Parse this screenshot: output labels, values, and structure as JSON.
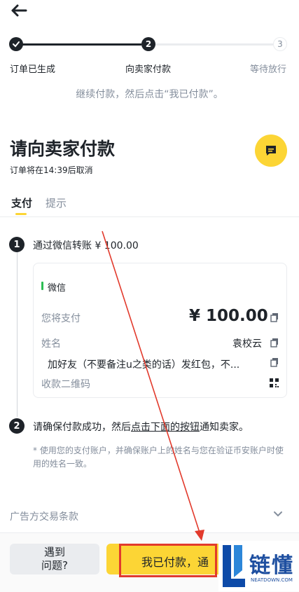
{
  "header": {
    "back_icon": "arrow-left-icon"
  },
  "stepper": {
    "steps": [
      {
        "label": "订单已生成",
        "number": "",
        "state": "done"
      },
      {
        "label": "向卖家付款",
        "number": "2",
        "state": "active"
      },
      {
        "label": "等待放行",
        "number": "3",
        "state": "pending"
      }
    ]
  },
  "hint": "继续付款，然后点击“我已付款”。",
  "page_title": "请向卖家付款",
  "cancel_info": "订单将在14:39后取消",
  "tabs": [
    {
      "label": "支付",
      "active": true
    },
    {
      "label": "提示",
      "active": false
    }
  ],
  "step1": {
    "number": "1",
    "text": "通过微信转账 ¥ 100.00"
  },
  "payment_card": {
    "method": "微信",
    "method_color": "#2dbd54",
    "amount_label": "您将支付",
    "amount_value": "¥ 100.00",
    "name_label": "姓名",
    "name_value": "袁校云",
    "remark_value": "加好友（不要备注u之类的话）发红包，不...",
    "qr_label": "收款二维码"
  },
  "step2": {
    "number": "2",
    "text_before": "请确保付款成功，然后",
    "text_link": "点击下面的按钮",
    "text_after": "通知卖家。"
  },
  "note": "* 使用您的支付账户，并确保账户上的姓名与您在验证币安账户时使用的姓名一致。",
  "terms": "广告方交易条款",
  "buttons": {
    "problem": "遇到\n问题?",
    "paid": "我已付款，通"
  },
  "watermark": {
    "brand": "链懂",
    "domain": "NEATDOWN.COM"
  },
  "colors": {
    "accent": "#fcd535",
    "annotation": "#e23a2c"
  }
}
